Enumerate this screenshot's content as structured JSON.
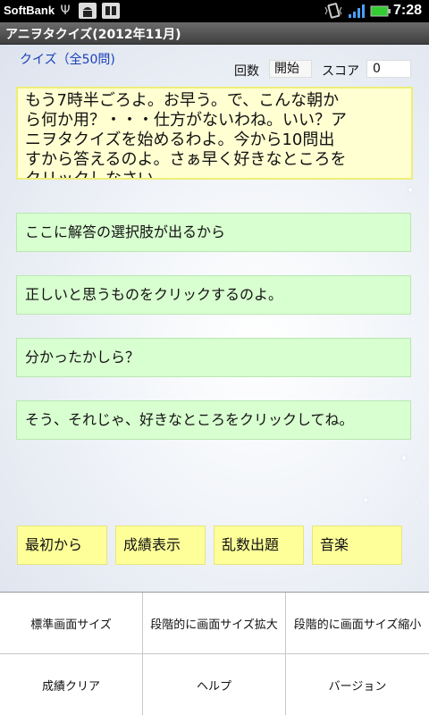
{
  "status_bar": {
    "carrier": "SoftBank",
    "time": "7:28",
    "icons": [
      "usb-icon",
      "android-icon",
      "sd-card-icon",
      "vibrate-icon",
      "signal-icon",
      "battery-icon"
    ],
    "battery_color": "#33cc33"
  },
  "app": {
    "title": "アニヲタクイズ(2012年11月)"
  },
  "quiz": {
    "title": "クイズ（全50問)",
    "round_label": "回数",
    "round_value": "開始",
    "score_label": "スコア",
    "score_value": "0"
  },
  "message_lines": [
    "もう7時半ごろよ。お早う。で、こんな朝か",
    "ら何か用？・・・仕方がないわね。いい？ア",
    "ニヲタクイズを始めるわよ。今から10問出",
    "すから答えるのよ。さぁ早く好きなところを",
    "クリックしなさい。"
  ],
  "choices": [
    "ここに解答の選択肢が出るから",
    "正しいと思うものをクリックするのよ。",
    "分かったかしら？",
    "そう、それじゃ、好きなところをクリックしてね。"
  ],
  "buttons": {
    "restart": "最初から",
    "show_score": "成績表示",
    "random": "乱数出題",
    "music": "音楽"
  },
  "menu": {
    "standard_size": "標準画面サイズ",
    "zoom_in": "段階的に画面サイズ拡大",
    "zoom_out": "段階的に画面サイズ縮小",
    "clear_score": "成績クリア",
    "help": "ヘルプ",
    "version": "バージョン"
  },
  "colors": {
    "quiz_title": "#1a3fb8",
    "message_bg": "#ffffd2",
    "choice_bg": "#d8ffd0",
    "button_bg": "#ffff99"
  }
}
